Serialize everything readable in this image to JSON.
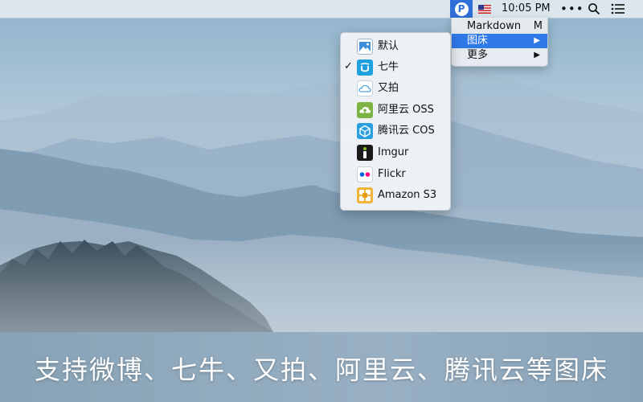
{
  "menubar": {
    "app_icon_letter": "P",
    "clock": "10:05 PM",
    "more_dots": "•••"
  },
  "menu": {
    "items": [
      {
        "label": "Markdown",
        "shortcut": "M"
      },
      {
        "label": "图床",
        "arrow": "▶"
      },
      {
        "label": "更多",
        "arrow": "▶"
      }
    ]
  },
  "submenu": {
    "checkmark": "✓",
    "items": [
      {
        "label": "默认",
        "icon": "image-icon"
      },
      {
        "label": "七牛",
        "icon": "qiniu-icon"
      },
      {
        "label": "又拍",
        "icon": "cloud-icon"
      },
      {
        "label": "阿里云 OSS",
        "icon": "aliyun-icon"
      },
      {
        "label": "腾讯云 COS",
        "icon": "tencent-cos-icon"
      },
      {
        "label": "Imgur",
        "icon": "imgur-icon"
      },
      {
        "label": "Flickr",
        "icon": "flickr-icon"
      },
      {
        "label": "Amazon S3",
        "icon": "amazon-s3-icon"
      }
    ]
  },
  "caption": "支持微博、七牛、又拍、阿里云、腾讯云等图床"
}
